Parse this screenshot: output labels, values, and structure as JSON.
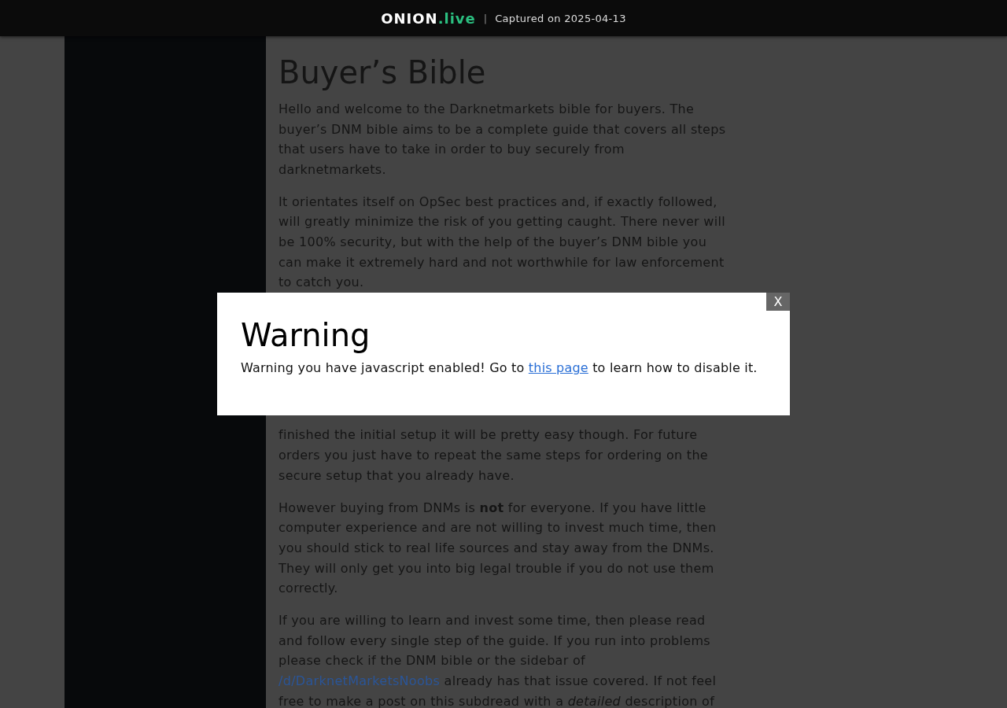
{
  "top_bar": {
    "brand": "ONION",
    "brand_suffix": ".live",
    "separator": "|",
    "caption": "Captured on 2025-04-13"
  },
  "article": {
    "title": "Buyer’s Bible",
    "paragraphs_above_modal": [
      [
        {
          "kind": "text",
          "text": "Hello and welcome to the Darknetmarkets bible for buyers. The buyer’s DNM bible aims to be a complete guide that covers all steps that users have to take in order to buy securely from darknetmarkets."
        }
      ],
      [
        {
          "kind": "text",
          "text": "It orientates itself on OpSec best practices and, if exactly followed, will greatly minimize the risk of you getting caught. There never will be 100% security, but with the help of the buyer’s DNM bible you can make it extremely hard and not worthwhile for law enforcement to catch you."
        }
      ]
    ],
    "paragraphs_below_modal": [
      [
        {
          "kind": "text",
          "text": "finished the initial setup it will be pretty easy though. For future orders you just have to repeat the same steps for ordering on the secure setup that you already have."
        }
      ],
      [
        {
          "kind": "text",
          "text": "However buying from DNMs is **not** for everyone. If you have little computer experience and are not willing to invest much time, then you should stick to real life sources and stay away from the DNMs. They will only get you into big legal trouble if you do not use them correctly."
        }
      ],
      [
        {
          "kind": "text",
          "text": "If you are willing to learn and invest some time, then please read and follow every single step of the guide. If you run into problems please check if the DNM bible or the sidebar of "
        },
        {
          "kind": "link",
          "text": "/d/DarknetMarketsNoobs"
        },
        {
          "kind": "text",
          "text": " already has that issue covered. If not feel free to make a post on this subdread with a *detailed* description of"
        }
      ]
    ]
  },
  "modal": {
    "close": "X",
    "title": "Warning",
    "message": [
      {
        "kind": "text",
        "text": "Warning you have javascript enabled! Go to "
      },
      {
        "kind": "link",
        "text": "this page"
      },
      {
        "kind": "text",
        "text": " to learn how to disable it."
      }
    ]
  }
}
